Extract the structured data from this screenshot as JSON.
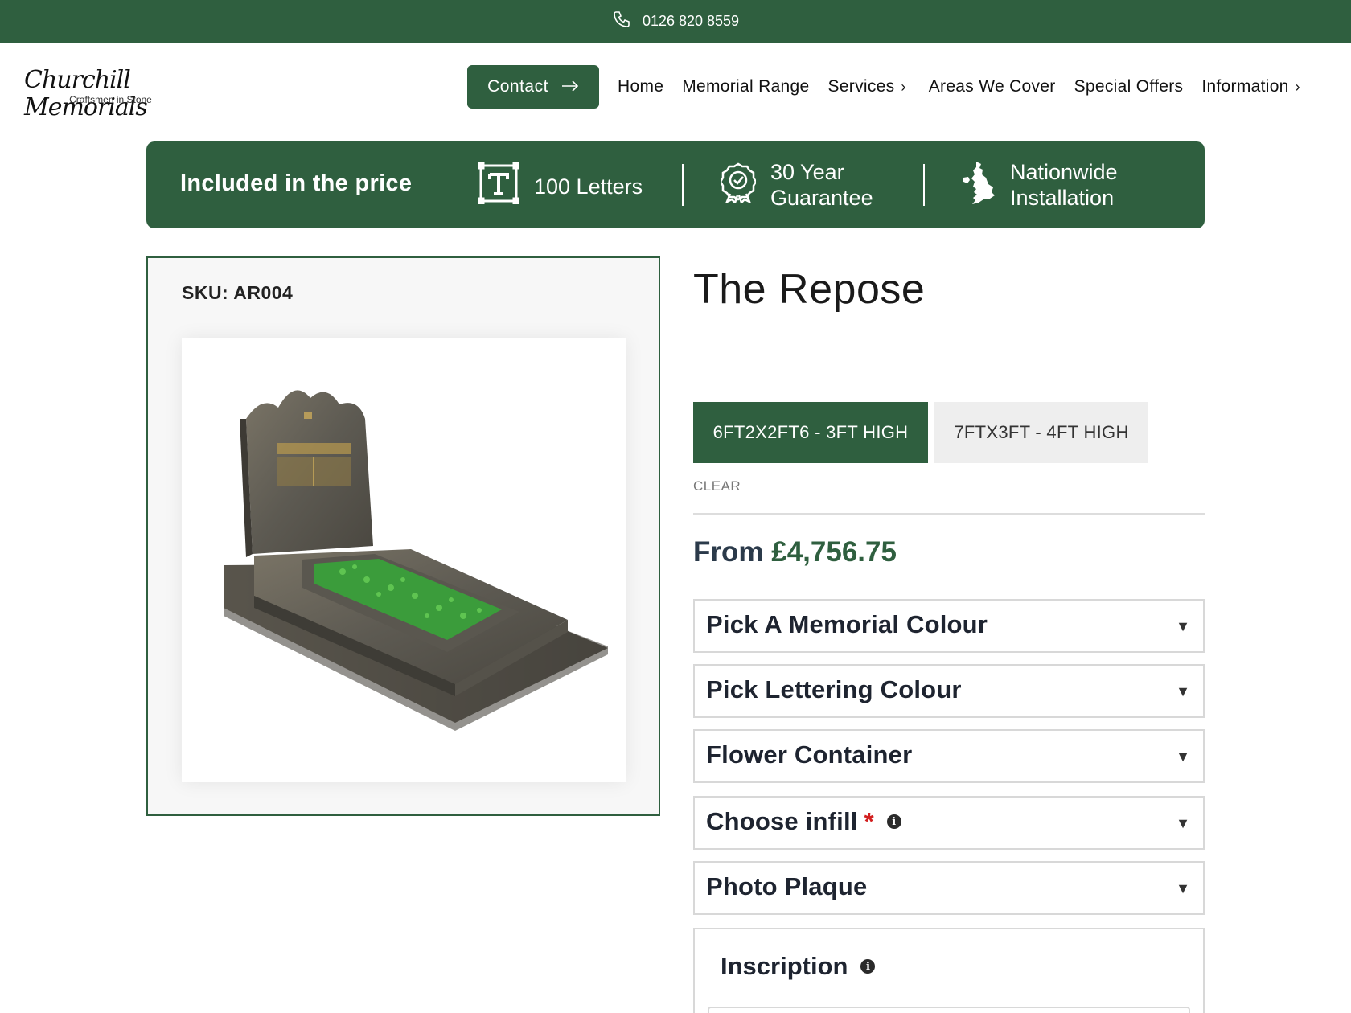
{
  "topbar": {
    "phone": "0126 820 8559"
  },
  "brand": {
    "name": "Churchill Memorials",
    "tagline": "Craftsmen in Stone"
  },
  "nav": {
    "contact_label": "Contact",
    "items": [
      "Home",
      "Memorial Range",
      "Services",
      "Areas We Cover",
      "Special Offers",
      "Information"
    ]
  },
  "included": {
    "title": "Included in the price",
    "features": [
      {
        "icon": "text-icon",
        "label": "100 Letters"
      },
      {
        "icon": "award-badge-icon",
        "line1": "30 Year",
        "line2": "Guarantee"
      },
      {
        "icon": "uk-map-icon",
        "line1": "Nationwide",
        "line2": "Installation"
      }
    ]
  },
  "product": {
    "sku": "SKU: AR004",
    "title": "The Repose",
    "sizes": [
      "6FT2X2FT6 - 3FT HIGH",
      "7FTX3FT - 4FT HIGH"
    ],
    "selected_size": "6FT2X2FT6 - 3FT HIGH",
    "clear_label": "CLEAR",
    "price_prefix": "From",
    "price": "£4,756.75"
  },
  "options": [
    {
      "label": "Pick A Memorial Colour"
    },
    {
      "label": "Pick Lettering Colour"
    },
    {
      "label": "Flower Container"
    },
    {
      "label": "Choose infill",
      "required": "*"
    },
    {
      "label": "Photo Plaque"
    }
  ],
  "inscription": {
    "label": "Inscription"
  },
  "colors": {
    "brand_green": "#2f5f3f",
    "price_green": "#2f5f3f",
    "required_red": "#d21f1f"
  }
}
